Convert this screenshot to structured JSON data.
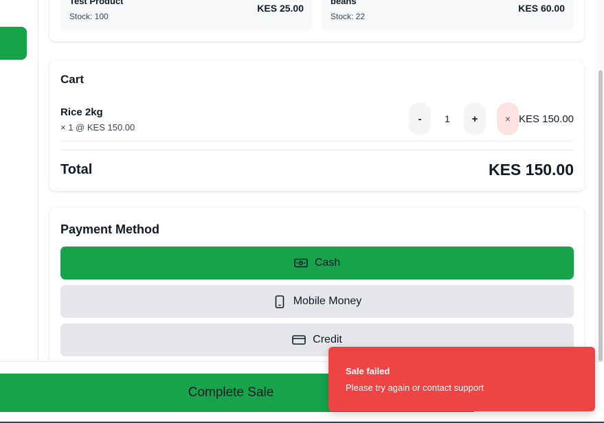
{
  "products": [
    {
      "name": "Test Product",
      "stock": "Stock: 100",
      "price": "KES 25.00"
    },
    {
      "name": "beans",
      "stock": "Stock: 22",
      "price": "KES 60.00"
    }
  ],
  "cart": {
    "title": "Cart",
    "items": [
      {
        "name": "Rice 2kg",
        "detail": "× 1 @ KES 150.00",
        "decrement_label": "-",
        "quantity": "1",
        "increment_label": "+",
        "remove_label": "×",
        "line_total": "KES 150.00"
      }
    ],
    "total_label": "Total",
    "total_value": "KES 150.00"
  },
  "payment": {
    "title": "Payment Method",
    "selected": "Cash",
    "options": [
      {
        "label": "Cash",
        "icon": "banknote-icon"
      },
      {
        "label": "Mobile Money",
        "icon": "smartphone-icon"
      },
      {
        "label": "Credit",
        "icon": "credit-card-icon"
      }
    ]
  },
  "actions": {
    "complete_sale": "Complete Sale"
  },
  "toast": {
    "title": "Sale failed",
    "description": "Please try again or contact support"
  },
  "colors": {
    "accent_green": "#16a34a",
    "toast_red": "#ef4444",
    "remove_pink": "#fde2e2",
    "button_gray": "#e5e7eb"
  }
}
